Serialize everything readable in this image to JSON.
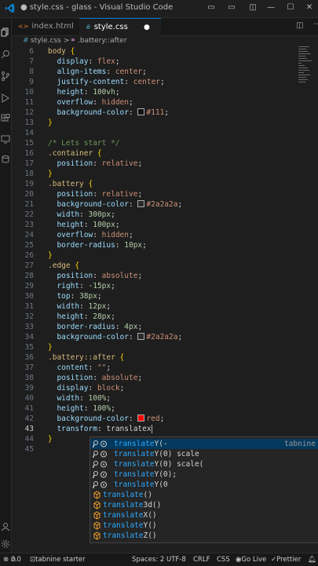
{
  "window": {
    "title": "● style.css - glass - Visual Studio Code"
  },
  "tabs": [
    {
      "label": "index.html",
      "icon": "html-icon"
    },
    {
      "label": "style.css",
      "icon": "css-icon",
      "dirty_marker": "●"
    }
  ],
  "breadcrumb": {
    "file": "style.css",
    "separator": ">",
    "symbol": ".battery::after"
  },
  "editor": {
    "lines": [
      {
        "n": "6",
        "tokens": [
          [
            "sel",
            "body "
          ],
          [
            "brk",
            "{"
          ]
        ]
      },
      {
        "n": "7",
        "tokens": [
          [
            "pun",
            "  "
          ],
          [
            "prop",
            "display"
          ],
          [
            "pun",
            ": "
          ],
          [
            "val",
            "flex"
          ],
          [
            "pun",
            ";"
          ]
        ]
      },
      {
        "n": "8",
        "tokens": [
          [
            "pun",
            "  "
          ],
          [
            "prop",
            "align-items"
          ],
          [
            "pun",
            ": "
          ],
          [
            "val",
            "center"
          ],
          [
            "pun",
            ";"
          ]
        ]
      },
      {
        "n": "9",
        "tokens": [
          [
            "pun",
            "  "
          ],
          [
            "prop",
            "justify-content"
          ],
          [
            "pun",
            ": "
          ],
          [
            "val",
            "center"
          ],
          [
            "pun",
            ";"
          ]
        ]
      },
      {
        "n": "10",
        "tokens": [
          [
            "pun",
            "  "
          ],
          [
            "prop",
            "height"
          ],
          [
            "pun",
            ": "
          ],
          [
            "num",
            "100vh"
          ],
          [
            "pun",
            ";"
          ]
        ]
      },
      {
        "n": "11",
        "tokens": [
          [
            "pun",
            "  "
          ],
          [
            "prop",
            "overflow"
          ],
          [
            "pun",
            ": "
          ],
          [
            "val",
            "hidden"
          ],
          [
            "pun",
            ";"
          ]
        ]
      },
      {
        "n": "12",
        "tokens": [
          [
            "pun",
            "  "
          ],
          [
            "prop",
            "background-color"
          ],
          [
            "pun",
            ": "
          ],
          [
            "swatch",
            "#111111"
          ],
          [
            "val",
            "#111"
          ],
          [
            "pun",
            ";"
          ]
        ]
      },
      {
        "n": "13",
        "tokens": [
          [
            "brk",
            "}"
          ]
        ]
      },
      {
        "n": "14",
        "tokens": []
      },
      {
        "n": "15",
        "tokens": [
          [
            "com",
            "/* Lets start */"
          ]
        ]
      },
      {
        "n": "16",
        "tokens": [
          [
            "sel",
            ".container "
          ],
          [
            "brk",
            "{"
          ]
        ]
      },
      {
        "n": "17",
        "tokens": [
          [
            "pun",
            "  "
          ],
          [
            "prop",
            "position"
          ],
          [
            "pun",
            ": "
          ],
          [
            "val",
            "relative"
          ],
          [
            "pun",
            ";"
          ]
        ]
      },
      {
        "n": "18",
        "tokens": [
          [
            "brk",
            "}"
          ]
        ]
      },
      {
        "n": "19",
        "tokens": [
          [
            "sel",
            ".battery "
          ],
          [
            "brk",
            "{"
          ]
        ]
      },
      {
        "n": "20",
        "tokens": [
          [
            "pun",
            "  "
          ],
          [
            "prop",
            "position"
          ],
          [
            "pun",
            ": "
          ],
          [
            "val",
            "relative"
          ],
          [
            "pun",
            ";"
          ]
        ]
      },
      {
        "n": "21",
        "tokens": [
          [
            "pun",
            "  "
          ],
          [
            "prop",
            "background-color"
          ],
          [
            "pun",
            ": "
          ],
          [
            "swatch",
            "#2a2a2a"
          ],
          [
            "val",
            "#2a2a2a"
          ],
          [
            "pun",
            ";"
          ]
        ]
      },
      {
        "n": "22",
        "tokens": [
          [
            "pun",
            "  "
          ],
          [
            "prop",
            "width"
          ],
          [
            "pun",
            ": "
          ],
          [
            "num",
            "300px"
          ],
          [
            "pun",
            ";"
          ]
        ]
      },
      {
        "n": "23",
        "tokens": [
          [
            "pun",
            "  "
          ],
          [
            "prop",
            "height"
          ],
          [
            "pun",
            ": "
          ],
          [
            "num",
            "100px"
          ],
          [
            "pun",
            ";"
          ]
        ]
      },
      {
        "n": "24",
        "tokens": [
          [
            "pun",
            "  "
          ],
          [
            "prop",
            "overflow"
          ],
          [
            "pun",
            ": "
          ],
          [
            "val",
            "hidden"
          ],
          [
            "pun",
            ";"
          ]
        ]
      },
      {
        "n": "25",
        "tokens": [
          [
            "pun",
            "  "
          ],
          [
            "prop",
            "border-radius"
          ],
          [
            "pun",
            ": "
          ],
          [
            "num",
            "10px"
          ],
          [
            "pun",
            ";"
          ]
        ]
      },
      {
        "n": "26",
        "tokens": [
          [
            "brk",
            "}"
          ]
        ]
      },
      {
        "n": "27",
        "tokens": [
          [
            "sel",
            ".edge "
          ],
          [
            "brk",
            "{"
          ]
        ]
      },
      {
        "n": "28",
        "tokens": [
          [
            "pun",
            "  "
          ],
          [
            "prop",
            "position"
          ],
          [
            "pun",
            ": "
          ],
          [
            "val",
            "absolute"
          ],
          [
            "pun",
            ";"
          ]
        ]
      },
      {
        "n": "29",
        "tokens": [
          [
            "pun",
            "  "
          ],
          [
            "prop",
            "right"
          ],
          [
            "pun",
            ": "
          ],
          [
            "num",
            "-15px"
          ],
          [
            "pun",
            ";"
          ]
        ]
      },
      {
        "n": "30",
        "tokens": [
          [
            "pun",
            "  "
          ],
          [
            "prop",
            "top"
          ],
          [
            "pun",
            ": "
          ],
          [
            "num",
            "38px"
          ],
          [
            "pun",
            ";"
          ]
        ]
      },
      {
        "n": "31",
        "tokens": [
          [
            "pun",
            "  "
          ],
          [
            "prop",
            "width"
          ],
          [
            "pun",
            ": "
          ],
          [
            "num",
            "12px"
          ],
          [
            "pun",
            ";"
          ]
        ]
      },
      {
        "n": "32",
        "tokens": [
          [
            "pun",
            "  "
          ],
          [
            "prop",
            "height"
          ],
          [
            "pun",
            ": "
          ],
          [
            "num",
            "28px"
          ],
          [
            "pun",
            ";"
          ]
        ]
      },
      {
        "n": "33",
        "tokens": [
          [
            "pun",
            "  "
          ],
          [
            "prop",
            "border-radius"
          ],
          [
            "pun",
            ": "
          ],
          [
            "num",
            "4px"
          ],
          [
            "pun",
            ";"
          ]
        ]
      },
      {
        "n": "34",
        "tokens": [
          [
            "pun",
            "  "
          ],
          [
            "prop",
            "background-color"
          ],
          [
            "pun",
            ": "
          ],
          [
            "swatch",
            "#2a2a2a"
          ],
          [
            "val",
            "#2a2a2a"
          ],
          [
            "pun",
            ";"
          ]
        ]
      },
      {
        "n": "35",
        "tokens": [
          [
            "brk",
            "}"
          ]
        ]
      },
      {
        "n": "36",
        "tokens": [
          [
            "sel",
            ".battery::after "
          ],
          [
            "brk",
            "{"
          ]
        ]
      },
      {
        "n": "37",
        "tokens": [
          [
            "pun",
            "  "
          ],
          [
            "prop",
            "content"
          ],
          [
            "pun",
            ": "
          ],
          [
            "val",
            "\"\""
          ],
          [
            "pun",
            ";"
          ]
        ]
      },
      {
        "n": "38",
        "tokens": [
          [
            "pun",
            "  "
          ],
          [
            "prop",
            "position"
          ],
          [
            "pun",
            ": "
          ],
          [
            "val",
            "absolute"
          ],
          [
            "pun",
            ";"
          ]
        ]
      },
      {
        "n": "39",
        "tokens": [
          [
            "pun",
            "  "
          ],
          [
            "prop",
            "display"
          ],
          [
            "pun",
            ": "
          ],
          [
            "val",
            "block"
          ],
          [
            "pun",
            ";"
          ]
        ]
      },
      {
        "n": "40",
        "tokens": [
          [
            "pun",
            "  "
          ],
          [
            "prop",
            "width"
          ],
          [
            "pun",
            ": "
          ],
          [
            "num",
            "100%"
          ],
          [
            "pun",
            ";"
          ]
        ]
      },
      {
        "n": "41",
        "tokens": [
          [
            "pun",
            "  "
          ],
          [
            "prop",
            "height"
          ],
          [
            "pun",
            ": "
          ],
          [
            "num",
            "100%"
          ],
          [
            "pun",
            ";"
          ]
        ]
      },
      {
        "n": "42",
        "tokens": [
          [
            "pun",
            "  "
          ],
          [
            "prop",
            "background-color"
          ],
          [
            "pun",
            ": "
          ],
          [
            "swatch",
            "#ff0000"
          ],
          [
            "val",
            "red"
          ],
          [
            "pun",
            ";"
          ]
        ]
      },
      {
        "n": "43",
        "tokens": [
          [
            "pun",
            "  "
          ],
          [
            "prop",
            "transform"
          ],
          [
            "pun",
            ": translatex"
          ]
        ]
      },
      {
        "n": "44",
        "tokens": [
          [
            "brk",
            "}"
          ]
        ]
      },
      {
        "n": "45",
        "tokens": []
      }
    ],
    "current_line": "43"
  },
  "autocomplete": {
    "detail": "tabnine",
    "items": [
      {
        "label": "translateY(-",
        "kind": "tabnine",
        "match": "translate"
      },
      {
        "label": "translateY(0) scale",
        "kind": "tabnine",
        "match": "translate"
      },
      {
        "label": "translateY(0) scale(",
        "kind": "tabnine",
        "match": "translate"
      },
      {
        "label": "translateY(0);",
        "kind": "tabnine",
        "match": "translate"
      },
      {
        "label": "translateY(0",
        "kind": "tabnine",
        "match": "translate"
      },
      {
        "label": "translate()",
        "kind": "function",
        "match": "translate"
      },
      {
        "label": "translate3d()",
        "kind": "function",
        "match": "translate"
      },
      {
        "label": "translateX()",
        "kind": "function",
        "match": "translate"
      },
      {
        "label": "translateY()",
        "kind": "function",
        "match": "translate"
      },
      {
        "label": "translateZ()",
        "kind": "function",
        "match": "translate"
      }
    ]
  },
  "statusbar": {
    "problems": "0",
    "warnings": "0",
    "tabnine": "tabnine starter",
    "spaces": "Spaces: 2",
    "encoding": "UTF-8",
    "eol": "CRLF",
    "language": "CSS",
    "golive": "Go Live",
    "prettier": "Prettier"
  },
  "colors": {
    "accent": "#0078d4",
    "selector": "#d7ba7d",
    "property": "#9cdcfe",
    "value": "#ce9178",
    "number": "#b5cea8",
    "comment": "#6a9955"
  }
}
